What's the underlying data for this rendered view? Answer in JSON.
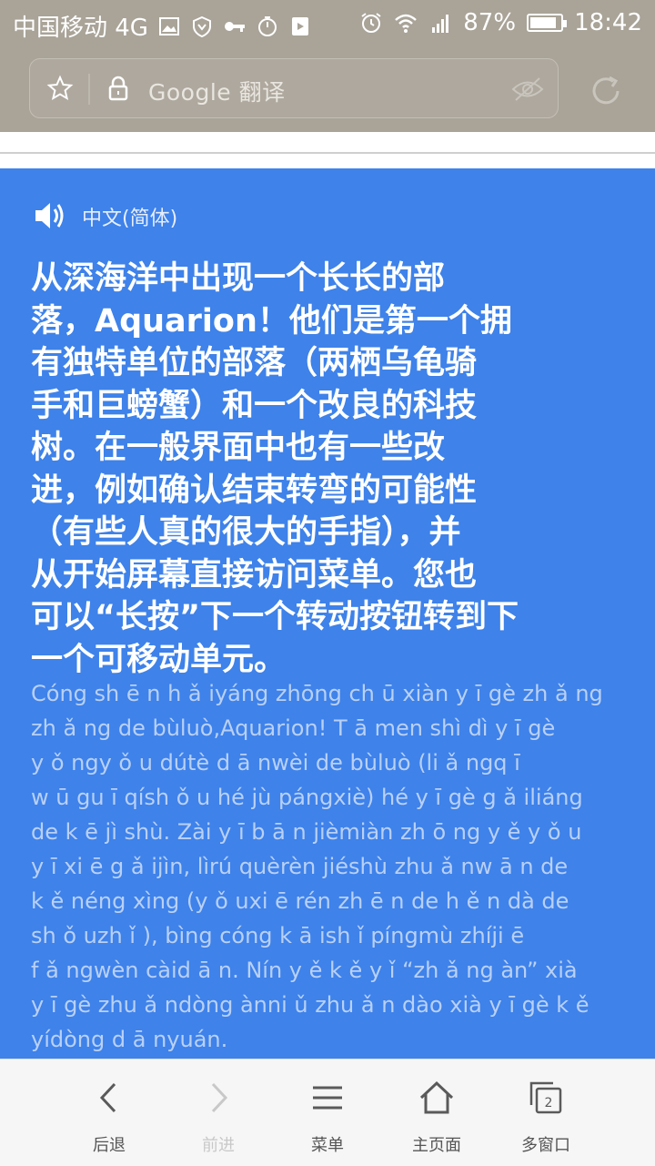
{
  "status_bar": {
    "carrier": "中国移动 4G",
    "battery": "87%",
    "battery_level": 0.87,
    "time": "18:42",
    "icons_left": [
      "image-icon",
      "vpn-shield-icon",
      "key-icon",
      "stopwatch-icon",
      "app-notification-icon"
    ],
    "icons_right": [
      "alarm-icon",
      "wifi-icon",
      "cellular-4g-icon",
      "battery-icon"
    ]
  },
  "toolbar": {
    "url_text": "Google 翻译",
    "icons": [
      "star-icon",
      "lock-icon",
      "eye-off-icon",
      "reload-icon"
    ]
  },
  "panel": {
    "color": "#3e82ea",
    "language": "中文(简体)",
    "translation_lines": [
      "从深海洋中出现一个长长的部",
      "落，Aquarion！他们是第一个拥",
      "有独特单位的部落（两栖乌龟骑",
      "手和巨螃蟹）和一个改良的科技",
      "树。在一般界面中也有一些改",
      "进，例如确认结束转弯的可能性",
      "（有些人真的很大的手指），并",
      "从开始屏幕直接访问菜单。您也",
      "可以“长按”下一个转动按钮转到下",
      "一个可移动单元。"
    ],
    "pinyin_lines": [
      "Cóng sh ē n h ǎ iyáng zhōng ch ū xiàn y ī gè zh ǎ ng",
      "zh ǎ ng de bùluò,Aquarion! T ā men shì dì y ī gè",
      "y ǒ ngy ǒ u dútè d ā nwèi de bùluò (li ǎ ngq ī",
      "w ū gu ī  qísh ǒ u hé jù pángxiè) hé y ī gè g ǎ iliáng",
      "de k ē jì shù. Zài y ī b ā n jièmiàn zh ō ng y ě y ǒ u",
      "y ī xi ē  g ǎ ijìn, lìrú quèrèn jiéshù zhu ǎ nw ā n de",
      "k ě néng xìng (y ǒ uxi ē  rén zh ē n de h ě n dà de",
      "sh ǒ uzh ǐ ), bìng cóng k ā ish ǐ  píngmù zhíji ē",
      "f ǎ ngwèn càid ā n. Nín y ě  k ě y ǐ  “zh ǎ ng àn” xià",
      "y ī gè zhu ǎ ndòng ànni ǔ  zhu ǎ n dào xià y ī  gè k ě",
      "yídòng d ā nyuán."
    ]
  },
  "bottom_nav": {
    "items": [
      {
        "label": "后退",
        "icon": "back-chevron-icon",
        "enabled": true
      },
      {
        "label": "前进",
        "icon": "forward-chevron-icon",
        "enabled": false
      },
      {
        "label": "菜单",
        "icon": "menu-icon",
        "enabled": true
      },
      {
        "label": "主页面",
        "icon": "home-icon",
        "enabled": true
      },
      {
        "label": "多窗口",
        "icon": "windows-icon",
        "enabled": true,
        "badge": "2"
      }
    ]
  }
}
